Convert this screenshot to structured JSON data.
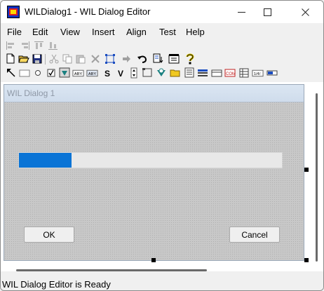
{
  "window": {
    "title": "WILDialog1 - WIL Dialog Editor",
    "icon": "app-icon",
    "controls": [
      "minimize-icon",
      "maximize-icon",
      "close-icon"
    ]
  },
  "menu": [
    "File",
    "Edit",
    "View",
    "Insert",
    "Align",
    "Test",
    "Help"
  ],
  "toolbar_align": [
    "align-left-icon",
    "align-right-icon",
    "align-top-icon",
    "align-bottom-icon"
  ],
  "toolbar_main": [
    "new-icon",
    "open-icon",
    "save-icon",
    "cut-icon",
    "copy-icon",
    "paste-icon",
    "delete-icon",
    "resize-icon",
    "forward-icon",
    "undo-icon",
    "import-icon",
    "properties-icon",
    "help-icon"
  ],
  "toolbar_controls": [
    "pointer-icon",
    "editbox-icon",
    "radio-icon",
    "checkbox-icon",
    "picture-button-icon",
    "static-text-icon",
    "vary-text-icon",
    "s-icon",
    "v-icon",
    "spinner-icon",
    "groupbox-icon",
    "picture-icon",
    "file-list-icon",
    "item-box-icon",
    "menu-bar-icon",
    "report-view-icon",
    "combo-icon",
    "grid-icon",
    "calendar-icon",
    "progress-bar-icon"
  ],
  "dialog": {
    "title": "WIL Dialog 1",
    "progress": 0.2,
    "ok_label": "OK",
    "cancel_label": "Cancel"
  },
  "status": "WIL Dialog Editor is Ready",
  "colors": {
    "progress": "#0a74d6",
    "titlebar_text": "#8e98a6"
  }
}
